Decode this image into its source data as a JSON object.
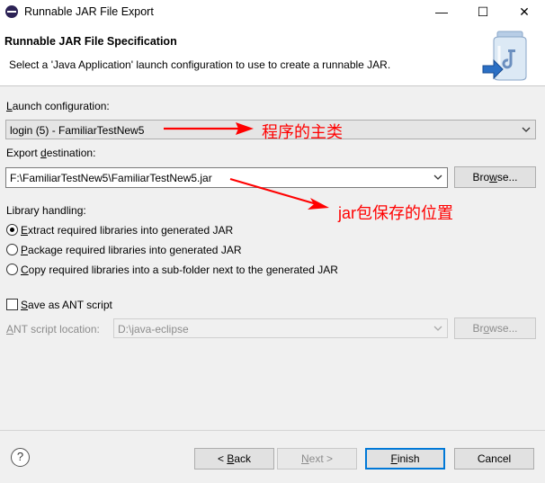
{
  "window": {
    "title": "Runnable JAR File Export",
    "minimize_glyph": "—",
    "maximize_glyph": "☐",
    "close_glyph": "✕"
  },
  "header": {
    "title": "Runnable JAR File Specification",
    "description": "Select a 'Java Application' launch configuration to use to create a runnable JAR."
  },
  "launch": {
    "label_mnemonic": "L",
    "label_rest": "aunch configuration:",
    "value": "login (5) - FamiliarTestNew5"
  },
  "destination": {
    "label_start": "Export ",
    "label_mnemonic": "d",
    "label_rest": "estination:",
    "value": "F:\\FamiliarTestNew5\\FamiliarTestNew5.jar",
    "browse_mnemonic": "w",
    "browse_start": "Bro",
    "browse_rest": "se..."
  },
  "library": {
    "label": "Library handling:",
    "options": [
      {
        "mnemonic": "E",
        "rest": "xtract required libraries into generated JAR",
        "selected": true
      },
      {
        "mnemonic": "P",
        "rest": "ackage required libraries into generated JAR",
        "selected": false
      },
      {
        "mnemonic": "C",
        "rest": "opy required libraries into a sub-folder next to the generated JAR",
        "selected": false
      }
    ]
  },
  "ant": {
    "checkbox_mnemonic": "S",
    "checkbox_rest": "ave as ANT script",
    "checked": false,
    "location_mnemonic": "A",
    "location_rest": "NT script location:",
    "location_value": "D:\\java-eclipse",
    "browse_mnemonic": "o",
    "browse_start": "Br",
    "browse_rest": "wse..."
  },
  "buttons": {
    "help": "?",
    "back_prefix": "< ",
    "back_mnemonic": "B",
    "back_rest": "ack",
    "next_mnemonic": "N",
    "next_rest": "ext >",
    "finish_mnemonic": "F",
    "finish_rest": "inish",
    "cancel": "Cancel"
  },
  "annotations": {
    "main_class": "程序的主类",
    "jar_location": "jar包保存的位置"
  },
  "colors": {
    "annotation": "#ff0000",
    "focus": "#0078d7",
    "disabled": "#8c8c8c"
  }
}
